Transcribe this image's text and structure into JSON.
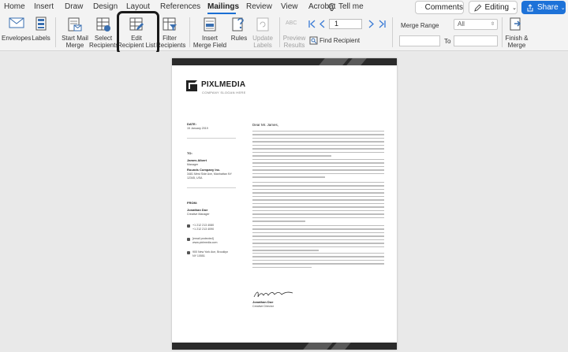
{
  "tabs": [
    "Home",
    "Insert",
    "Draw",
    "Design",
    "Layout",
    "References",
    "Mailings",
    "Review",
    "View",
    "Acrobat"
  ],
  "active_tab": "Mailings",
  "tell_me": "Tell me",
  "comments_label": "Comments",
  "editing_label": "Editing",
  "share_label": "Share",
  "ribbon": {
    "envelopes": "Envelopes",
    "labels": "Labels",
    "start_mail_merge": [
      "Start Mail",
      "Merge"
    ],
    "select_recipients": [
      "Select",
      "Recipients"
    ],
    "edit_recipient_list": [
      "Edit",
      "Recipient List"
    ],
    "filter_recipients": [
      "Filter",
      "Recipients"
    ],
    "insert_merge_field": [
      "Insert",
      "Merge Field"
    ],
    "rules": "Rules",
    "update_labels": [
      "Update",
      "Labels"
    ],
    "preview_results": [
      "Preview",
      "Results"
    ],
    "abc_glyph": "ABC",
    "record_number": "1",
    "find_recipient": "Find Recipient",
    "merge_range_label": "Merge Range",
    "merge_range_value": "All",
    "to_label": "To",
    "finish_merge": [
      "Finish &",
      "Merge"
    ]
  },
  "document": {
    "company": "PIXLMEDIA",
    "slogan": "COMPANY SLOGAN HERE",
    "date_label": "DATE:",
    "date_value": "15 January 2019",
    "to_label": "TO:",
    "to_name": "James Albert",
    "to_title": "Manager",
    "to_company": "Rounds Company Inc.",
    "to_address": [
      "3481 Mest Side Ave, Manhattan NY",
      "12345, USA"
    ],
    "from_label": "FROM:",
    "from_name": "Jonathan Doe",
    "from_title": "Creative Manager",
    "phones": [
      "+1 212 213 4080",
      "+1 212 213 4090"
    ],
    "web": [
      "[email protected]",
      "www.pixlmedia.com"
    ],
    "address": [
      "900 New York Ave, Brooklyn",
      "NY 10551"
    ],
    "greeting": "Dear Mr. James,",
    "sign_name": "Jonathan Doe",
    "sign_title": "Creative Director"
  }
}
